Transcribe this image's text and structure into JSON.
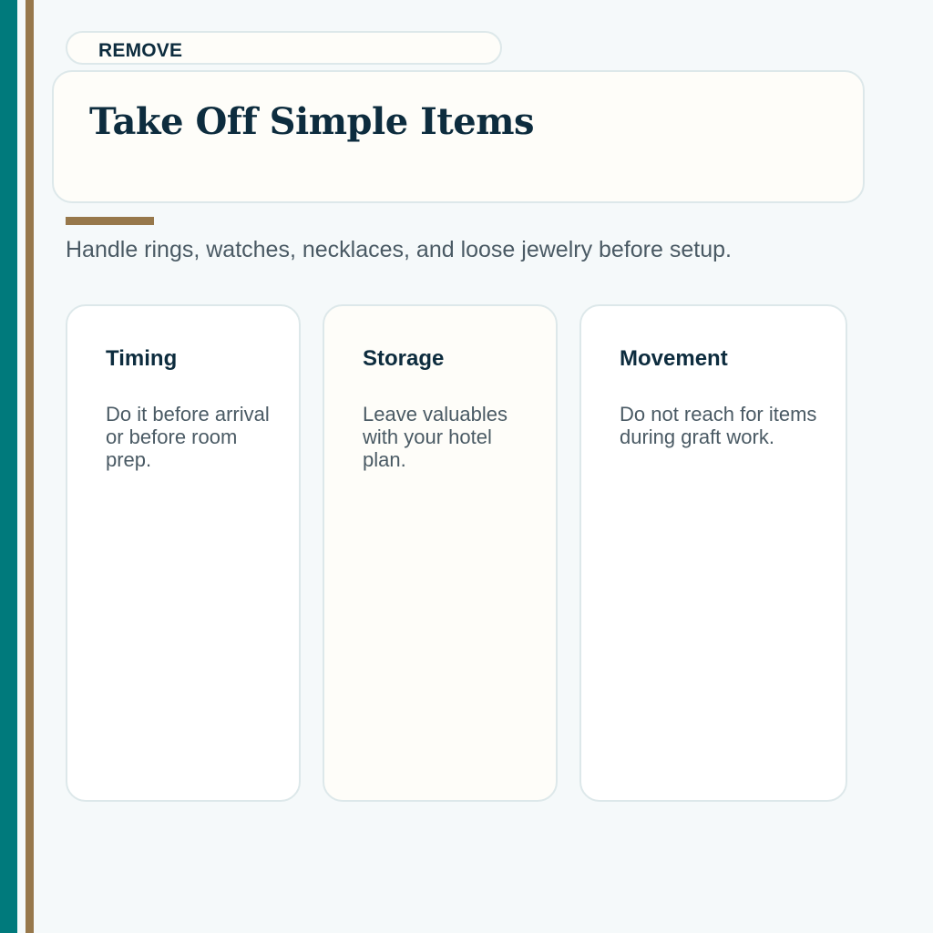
{
  "tag": "REMOVE",
  "title": "Take Off Simple Items",
  "subtitle": "Handle rings, watches, necklaces, and loose jewelry before setup.",
  "cards": [
    {
      "title": "Timing",
      "body": "Do it before arrival or before room prep."
    },
    {
      "title": "Storage",
      "body": "Leave valuables with your hotel plan."
    },
    {
      "title": "Movement",
      "body": "Do not reach for items during graft work."
    }
  ],
  "colors": {
    "teal_stripe": "#007a7c",
    "brown_accent": "#97784b",
    "heading": "#0d2c3e",
    "body_text": "#4a5a64",
    "cream_card": "#fefdf9",
    "page_background": "#f5f9fa",
    "border": "#dde8ea"
  }
}
